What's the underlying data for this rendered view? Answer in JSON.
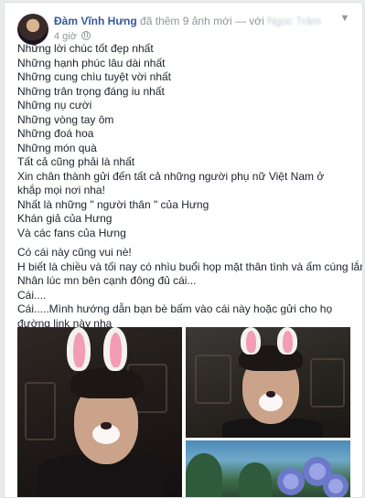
{
  "post": {
    "author": "Đàm Vĩnh Hưng",
    "action_text": "đã thêm 9 ảnh mới — với",
    "with_name": "Ngọc Trâm",
    "timestamp": "4 giờ",
    "privacy_icon": "globe-icon",
    "menu_icon": "chevron-down-icon"
  },
  "text": {
    "lines": [
      "Những lời chúc tốt đẹp nhất",
      "Những hạnh phúc lâu dài nhất",
      "Những cung chìu tuyệt vời nhất",
      "Những trân trọng đáng iu nhất",
      "Những nụ cười",
      "Những vòng tay ôm",
      "Những đoá hoa",
      "Những món quà",
      "Tất cả cũng phải là nhất",
      "Xin chân thành gửi đến tất cả những người phụ nữ Việt Nam ở khắp mọi nơi nha!",
      "Nhất là những \" người thân \" của Hưng",
      "Khán giả của Hưng",
      "Và các fans của Hưng",
      "Có cái này cũng vui nè!",
      "H biết là chiều và tối nay có nhìu buổi họp mặt thân tình và ấm cúng lắm....",
      "Nhân lúc mn bên cạnh đông đủ cái...",
      "Cái....",
      "Cái.....Mình hướng dẫn bạn bè bấm vào cái này hoặc gửi cho họ đường link này nha"
    ]
  },
  "colors": {
    "link_blue": "#365899",
    "meta_gray": "#90949c",
    "text": "#1d2129",
    "background": "#e9ebee"
  }
}
